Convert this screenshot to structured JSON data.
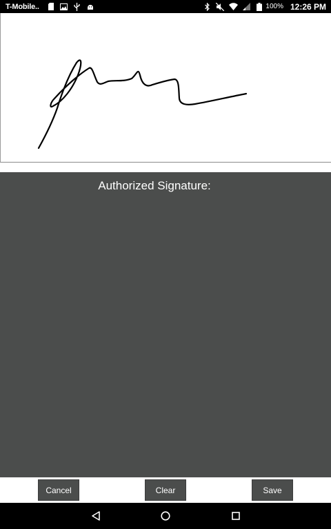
{
  "status_bar": {
    "carrier": "T-Mobile..",
    "battery_percent": "100%",
    "time": "12:26 PM",
    "icons_left": [
      "sim-card-icon",
      "image-icon",
      "usb-icon",
      "android-icon"
    ],
    "icons_right": [
      "bluetooth-icon",
      "mute-icon",
      "wifi-icon",
      "signal-icon",
      "battery-icon"
    ]
  },
  "signature_pad": {
    "ink_color": "#000000",
    "background": "#ffffff"
  },
  "signature_section": {
    "label": "Authorized Signature:",
    "background": "#4b4d4c"
  },
  "buttons": {
    "cancel_label": "Cancel",
    "clear_label": "Clear",
    "save_label": "Save",
    "button_color": "#4b4d4c"
  },
  "nav_bar": {
    "icons": [
      "back-icon",
      "home-icon",
      "recents-icon"
    ]
  }
}
